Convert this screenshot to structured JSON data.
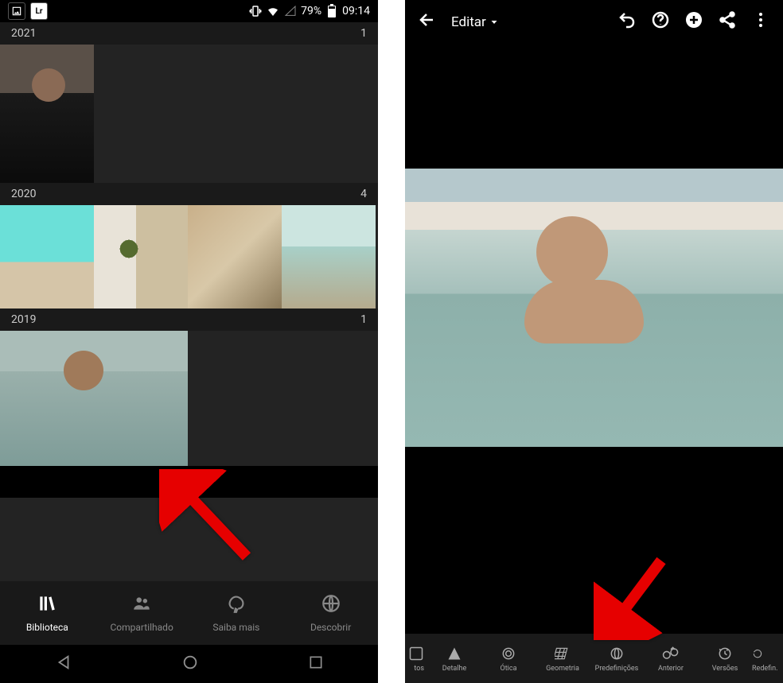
{
  "status_bar": {
    "battery_percent": "79%",
    "time": "09:14"
  },
  "library": {
    "groups": [
      {
        "year": "2021",
        "count": "1"
      },
      {
        "year": "2020",
        "count": "4"
      },
      {
        "year": "2019",
        "count": "1"
      }
    ]
  },
  "bottom_nav": {
    "biblioteca": "Biblioteca",
    "compartilhado": "Compartilhado",
    "saiba_mais": "Saiba mais",
    "descobrir": "Descobrir"
  },
  "editor": {
    "title": "Editar",
    "tools": {
      "partial_left": "tos",
      "detalhe": "Detalhe",
      "otica": "Ótica",
      "geometria": "Geometria",
      "predefinicoes": "Predefinições",
      "anterior": "Anterior",
      "versoes": "Versões",
      "redefinir": "Redefin."
    }
  }
}
